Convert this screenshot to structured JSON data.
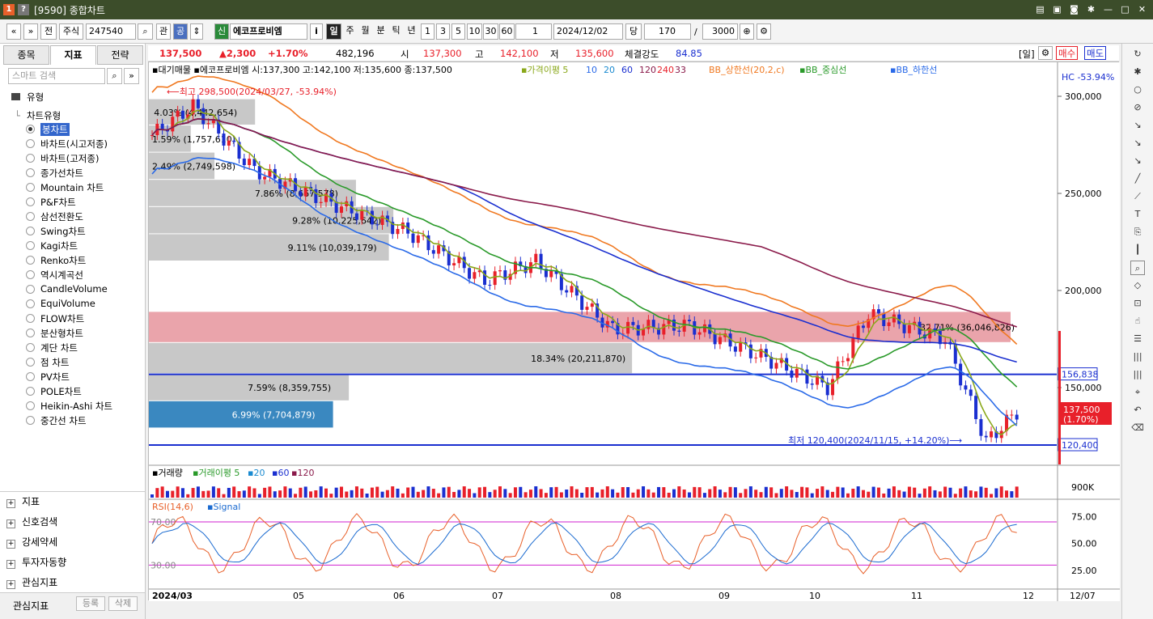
{
  "window": {
    "icon1": "1",
    "icon2": "?",
    "title": "[9590] 종합차트"
  },
  "toolbar": {
    "nav_back": "«",
    "nav_down": "»",
    "full": "전",
    "market": "주식",
    "code": "247540",
    "kan": "관",
    "gong": "공",
    "shin": "신",
    "stock_name": "에코프로비엠",
    "info": "i",
    "periods": [
      "일",
      "주",
      "월",
      "분",
      "틱",
      "년"
    ],
    "intervals": [
      "1",
      "3",
      "5",
      "10",
      "30",
      "60"
    ],
    "interval_value": "1",
    "date": "2024/12/02",
    "dang": "당",
    "count": "170",
    "slash": "/",
    "total": "3000"
  },
  "left_panel": {
    "tabs": [
      "종목",
      "지표",
      "전략"
    ],
    "search_placeholder": "스마트 검색",
    "root": "유형",
    "group": "차트유형",
    "chart_types": [
      "봉차트",
      "바차트(시고저종)",
      "바차트(고저종)",
      "종가선차트",
      "Mountain 차트",
      "P&F차트",
      "삼선전환도",
      "Swing차트",
      "Kagi차트",
      "Renko차트",
      "역시계곡선",
      "CandleVolume",
      "EquiVolume",
      "FLOW차트",
      "분산형차트",
      "계단 차트",
      "점 차트",
      "PV차트",
      "POLE차트",
      "Heikin-Ashi 차트",
      "중간선 차트"
    ],
    "sections": [
      "지표",
      "신호검색",
      "강세약세",
      "투자자동향",
      "관심지표"
    ],
    "footer_label": "관심지표",
    "footer_btn1": "등록",
    "footer_btn2": "삭제"
  },
  "infobar": {
    "price": "137,500",
    "change": "▲2,300",
    "rate": "+1.70%",
    "volume": "482,196",
    "open_label": "시",
    "open": "137,300",
    "high_label": "고",
    "high": "142,100",
    "low_label": "저",
    "low": "135,600",
    "strength_label": "체결강도",
    "strength": "84.85",
    "day_btn": "[일]",
    "buy": "매수",
    "sell": "매도"
  },
  "chart_data": {
    "type": "candlestick",
    "legend": "▪대기매물 ▪에코프로비엠 시:137,300 고:142,100 저:135,600 종:137,500",
    "legend_ma": "▪가격이평 5",
    "legend_ma_periods": [
      "10",
      "20",
      "60",
      "120",
      "240",
      "33"
    ],
    "legend_bb": [
      "BB_상한선(20,2,c)",
      "▪BB_중심선",
      "▪BB_하한선"
    ],
    "hc_label": "HC -53.94%",
    "max_label": "⟵최고 298,500(2024/03/27, -53.94%)",
    "min_label": "최저 120,400(2024/11/15, +14.20%)⟶",
    "y_ticks": [
      "300,000",
      "250,000",
      "200,000",
      "150,000"
    ],
    "y_tick_values": [
      300000,
      250000,
      200000,
      150000
    ],
    "ylim": [
      110000,
      305000
    ],
    "price_line_labels": [
      "156,838",
      "120,400"
    ],
    "price_line_values": [
      156838,
      120400
    ],
    "current_price_label": "137,500",
    "current_rate_label": "(1.70%)",
    "current_value": 137500,
    "volume_profile": [
      {
        "label": "4.03% (4,442,654)",
        "lo": 285000,
        "hi": 298500,
        "pct": 4.03
      },
      {
        "label": "1.59% (1,757,610)",
        "lo": 271000,
        "hi": 285000,
        "pct": 1.59
      },
      {
        "label": "2.49% (2,749,598)",
        "lo": 257000,
        "hi": 271000,
        "pct": 2.49
      },
      {
        "label": "7.86% (8,667,578)",
        "lo": 243000,
        "hi": 257000,
        "pct": 7.86
      },
      {
        "label": "9.28% (10,225,642)",
        "lo": 229000,
        "hi": 243000,
        "pct": 9.28
      },
      {
        "label": "9.11% (10,039,179)",
        "lo": 215000,
        "hi": 229000,
        "pct": 9.11
      },
      {
        "label": "32.71% (36,046,826)",
        "lo": 173000,
        "hi": 189000,
        "pct": 32.71
      },
      {
        "label": "18.34% (20,211,870)",
        "lo": 157000,
        "hi": 173000,
        "pct": 18.34
      },
      {
        "label": "7.59% (8,359,755)",
        "lo": 143000,
        "hi": 157000,
        "pct": 7.59
      },
      {
        "label": "6.99% (7,704,879)",
        "lo": 129000,
        "hi": 143000,
        "pct": 6.99
      }
    ],
    "x_ticks": [
      "2024/03",
      "05",
      "06",
      "07",
      "08",
      "09",
      "10",
      "11",
      "12"
    ],
    "x_end_label": "12/07",
    "volume_legend": [
      "▪거래량",
      "▪거래이평 5",
      "▪20",
      "▪60",
      "▪120"
    ],
    "volume_tick": "900K",
    "rsi_legend": [
      "RSI(14,6)",
      "▪Signal"
    ],
    "rsi_ticks": [
      "75.00",
      "50.00",
      "25.00"
    ],
    "rsi_tick_values": [
      75,
      50,
      25
    ],
    "rsi_levels": [
      "70.00",
      "30.00"
    ],
    "rsi_level_values": [
      70,
      30
    ]
  },
  "colors": {
    "up": "#e8202a",
    "down": "#1a2fd0",
    "ma5": "#8aa81a",
    "ma20": "#2a9a2a",
    "bb_upper": "#f07820",
    "bb_lower": "#2a6ae8",
    "accent_title": "#3c4d2a"
  }
}
